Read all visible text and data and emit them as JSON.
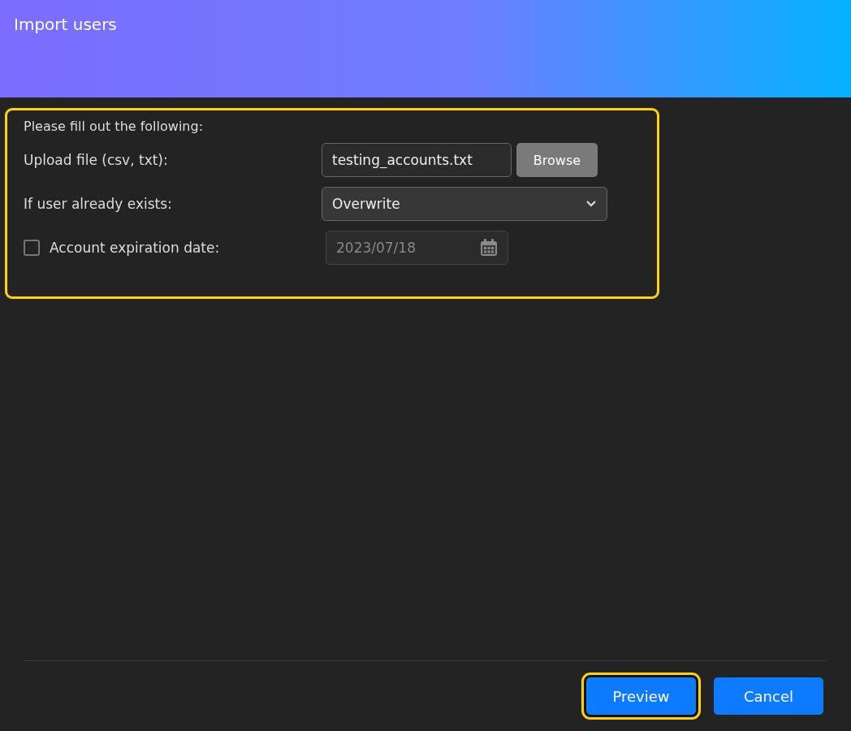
{
  "window": {
    "title": "Import users"
  },
  "form": {
    "highlighted": true,
    "intro": "Please fill out the following:",
    "upload": {
      "label": "Upload file (csv, txt):",
      "value": "testing_accounts.txt",
      "button": "Browse"
    },
    "exists": {
      "label": "If user already exists:",
      "value": "Overwrite"
    },
    "expiration": {
      "label": "Account expiration date:",
      "checked": false,
      "value": "2023/07/18",
      "disabled": true
    }
  },
  "buttons": [
    {
      "label": "Preview",
      "focused": true
    },
    {
      "label": "Cancel",
      "focused": false
    }
  ]
}
